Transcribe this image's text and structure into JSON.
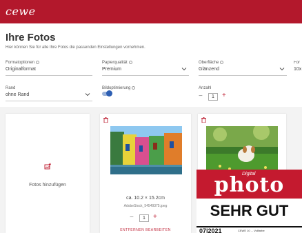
{
  "header": {
    "logo": "cewe",
    "brand_color": "#b3182c"
  },
  "page": {
    "title": "Ihre Fotos",
    "subtitle": "Hier können Sie für alle Ihre Fotos die passenden Einstellungen vornehmen."
  },
  "settings": {
    "format": {
      "label": "Formatoptionen",
      "value": "Originalformat"
    },
    "paper": {
      "label": "Papierqualität",
      "value": "Premium"
    },
    "surface": {
      "label": "Oberfläche",
      "value": "Glänzend"
    },
    "format2": {
      "label": "For",
      "value": "10x"
    },
    "border": {
      "label": "Rand",
      "value": "ohne Rand"
    },
    "optimize": {
      "label": "Bildoptimierung",
      "enabled": true
    },
    "quantity": {
      "label": "Anzahl",
      "minus": "−",
      "value": "1",
      "plus": "+"
    }
  },
  "cards": {
    "add": {
      "label": "Fotos hinzufügen",
      "icon": "add-photo-icon"
    },
    "photo1": {
      "size": "ca. 10.2 × 15.2cm",
      "file": "AdobeStock_54549375.jpeg",
      "minus": "−",
      "qty": "1",
      "plus": "+",
      "actions": "ENTFERNEN   BEARBEITEN",
      "icon": "trash-icon"
    },
    "photo2": {
      "icon": "trash-icon"
    }
  },
  "badge": {
    "digital": "Digital",
    "brand": "photo",
    "verdict": "SEHR GUT",
    "issue": "07|2021",
    "fine_print": "CEWE 10 ... Vollfarbe"
  }
}
